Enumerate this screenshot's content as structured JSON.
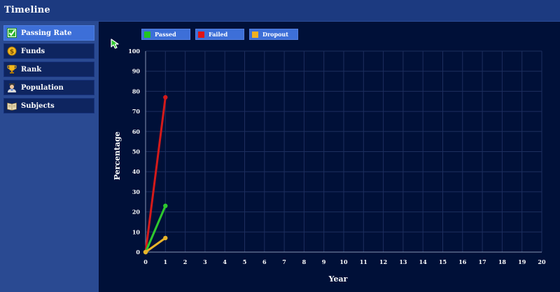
{
  "app": {
    "title": "Timeline"
  },
  "sidebar": {
    "items": [
      {
        "label": "Passing Rate",
        "icon": "checkbox-icon",
        "active": true
      },
      {
        "label": "Funds",
        "icon": "coin-icon",
        "active": false
      },
      {
        "label": "Rank",
        "icon": "trophy-icon",
        "active": false
      },
      {
        "label": "Population",
        "icon": "student-icon",
        "active": false
      },
      {
        "label": "Subjects",
        "icon": "book-icon",
        "active": false
      }
    ]
  },
  "legend": [
    {
      "label": "Passed",
      "color": "#22c422"
    },
    {
      "label": "Failed",
      "color": "#e01414"
    },
    {
      "label": "Dropout",
      "color": "#f0b020"
    }
  ],
  "chart_data": {
    "type": "line",
    "xlabel": "Year",
    "ylabel": "Percentage",
    "xlim": [
      0,
      20
    ],
    "ylim": [
      0,
      100
    ],
    "x_ticks": [
      0,
      1,
      2,
      3,
      4,
      5,
      6,
      7,
      8,
      9,
      10,
      11,
      12,
      13,
      14,
      15,
      16,
      17,
      18,
      19,
      20
    ],
    "y_ticks": [
      0,
      10,
      20,
      30,
      40,
      50,
      60,
      70,
      80,
      90,
      100
    ],
    "grid": true,
    "series": [
      {
        "name": "Failed",
        "color": "#d41a1a",
        "x": [
          0,
          1
        ],
        "y": [
          0,
          77
        ]
      },
      {
        "name": "Passed",
        "color": "#2ec82e",
        "x": [
          0,
          1
        ],
        "y": [
          0,
          23
        ]
      },
      {
        "name": "Dropout",
        "color": "#e8b42a",
        "x": [
          0,
          1
        ],
        "y": [
          0,
          7
        ]
      }
    ]
  }
}
